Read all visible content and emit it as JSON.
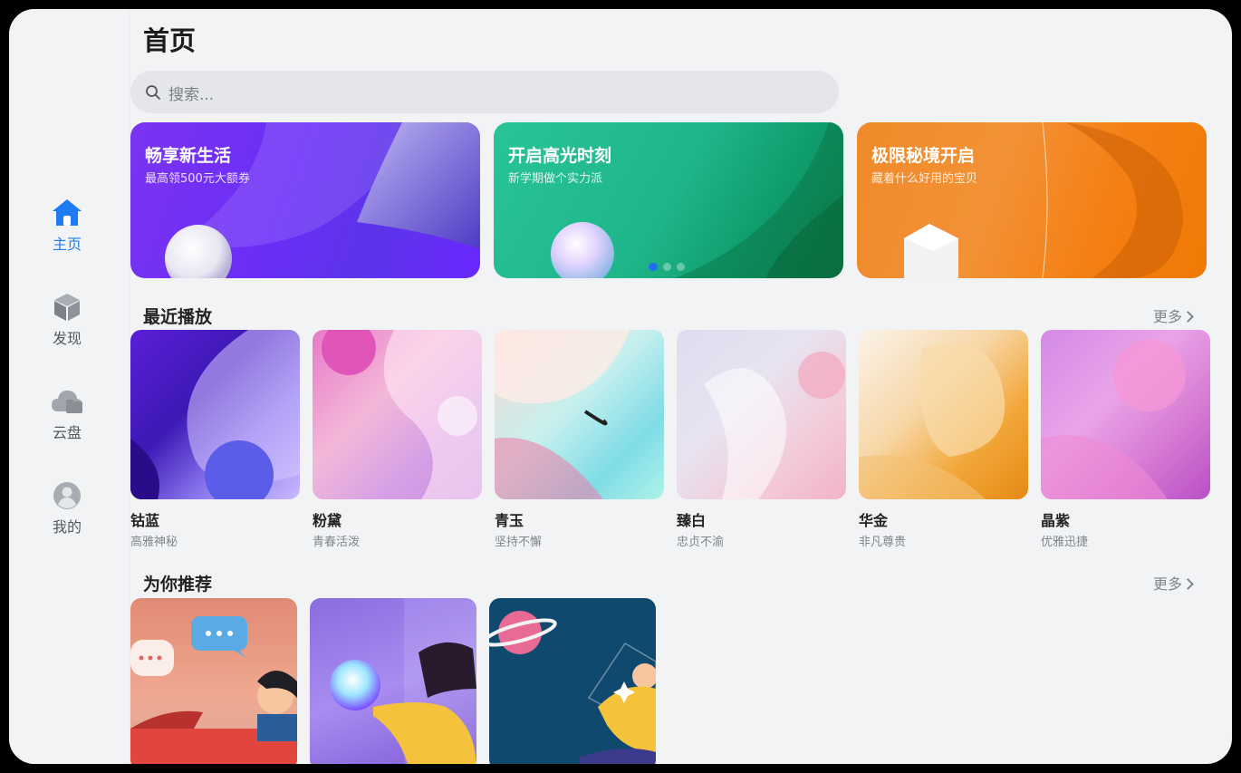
{
  "sidebar": {
    "items": [
      {
        "label": "主页",
        "icon": "home-icon",
        "active": true
      },
      {
        "label": "发现",
        "icon": "cube-icon"
      },
      {
        "label": "云盘",
        "icon": "cloud-icon"
      },
      {
        "label": "我的",
        "icon": "user-icon"
      }
    ]
  },
  "header": {
    "title": "首页"
  },
  "search": {
    "placeholder": "搜索..."
  },
  "banners": [
    {
      "title": "畅享新生活",
      "subtitle": "最高领500元大额券"
    },
    {
      "title": "开启高光时刻",
      "subtitle": "新学期做个实力派"
    },
    {
      "title": "极限秘境开启",
      "subtitle": "藏着什么好用的宝贝"
    }
  ],
  "recent": {
    "title": "最近播放",
    "more_label": "更多",
    "items": [
      {
        "name": "钴蓝",
        "desc": "高雅神秘"
      },
      {
        "name": "粉黛",
        "desc": "青春活泼"
      },
      {
        "name": "青玉",
        "desc": "坚持不懈"
      },
      {
        "name": "臻白",
        "desc": "忠贞不渝"
      },
      {
        "name": "华金",
        "desc": "非凡尊贵"
      },
      {
        "name": "晶紫",
        "desc": "优雅迅捷"
      }
    ]
  },
  "recommend": {
    "title": "为你推荐",
    "more_label": "更多"
  },
  "colors": {
    "accent": "#1e7bf2",
    "background": "#f1f3f5"
  }
}
